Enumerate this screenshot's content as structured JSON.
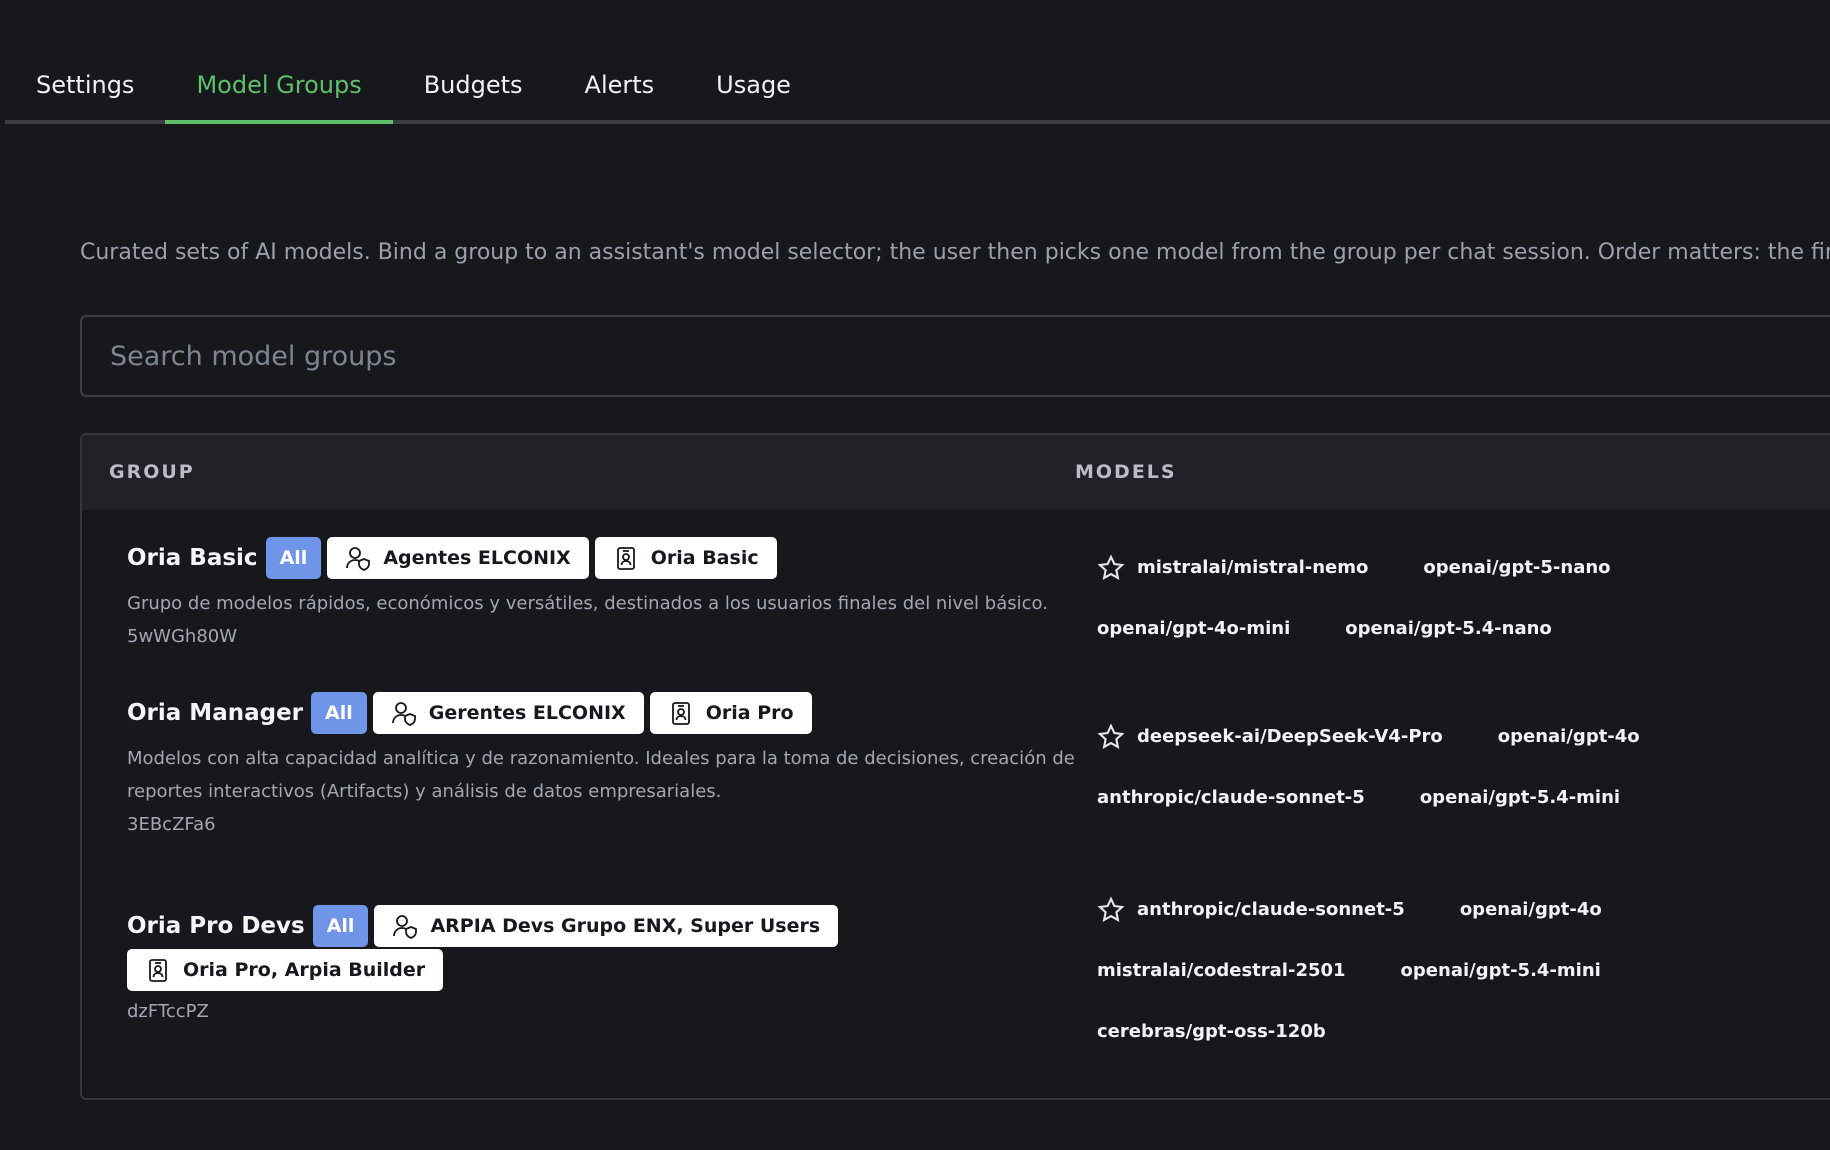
{
  "tabs": [
    {
      "label": "Settings",
      "active": false
    },
    {
      "label": "Model Groups",
      "active": true
    },
    {
      "label": "Budgets",
      "active": false
    },
    {
      "label": "Alerts",
      "active": false
    },
    {
      "label": "Usage",
      "active": false
    }
  ],
  "description": "Curated sets of AI models. Bind a group to an assistant's model selector; the user then picks one model from the group per chat session. Order matters: the first model",
  "search": {
    "placeholder": "Search model groups",
    "value": ""
  },
  "table": {
    "headers": {
      "group": "GROUP",
      "models": "MODELS"
    },
    "rows": [
      {
        "name": "Oria Basic",
        "badge": "All",
        "users_chip": "Agentes ELCONIX",
        "role_chip": "Oria Basic",
        "description": "Grupo de modelos rápidos, económicos y versátiles, destinados a los usuarios finales del nivel básico.",
        "description_2": "",
        "id": "5wWGh80W",
        "models": [
          "mistralai/mistral-nemo",
          "openai/gpt-5-nano",
          "openai/gpt-4o-mini",
          "openai/gpt-5.4-nano"
        ]
      },
      {
        "name": "Oria Manager",
        "badge": "All",
        "users_chip": "Gerentes ELCONIX",
        "role_chip": "Oria Pro",
        "description": "Modelos con alta capacidad analítica y de razonamiento. Ideales para la toma de decisiones, creación de",
        "description_2": "reportes interactivos (Artifacts) y análisis de datos empresariales.",
        "id": "3EBcZFa6",
        "models": [
          "deepseek-ai/DeepSeek-V4-Pro",
          "openai/gpt-4o",
          "anthropic/claude-sonnet-5",
          "openai/gpt-5.4-mini"
        ]
      },
      {
        "name": "Oria Pro Devs",
        "badge": "All",
        "users_chip": "ARPIA Devs Grupo ENX, Super Users",
        "role_chip": "Oria Pro, Arpia Builder",
        "description": "",
        "description_2": "",
        "id": "dzFTccPZ",
        "models": [
          "anthropic/claude-sonnet-5",
          "openai/gpt-4o",
          "mistralai/codestral-2501",
          "openai/gpt-5.4-mini",
          "cerebras/gpt-oss-120b"
        ]
      }
    ]
  },
  "icons": {
    "users_chip_icon": "user-shield-icon",
    "role_chip_icon": "id-badge-icon",
    "default_model_icon": "star-outline-icon"
  },
  "colors": {
    "accent_active_tab": "#5fbf6a",
    "badge_all": "#6f94e8",
    "background": "#16181c"
  }
}
